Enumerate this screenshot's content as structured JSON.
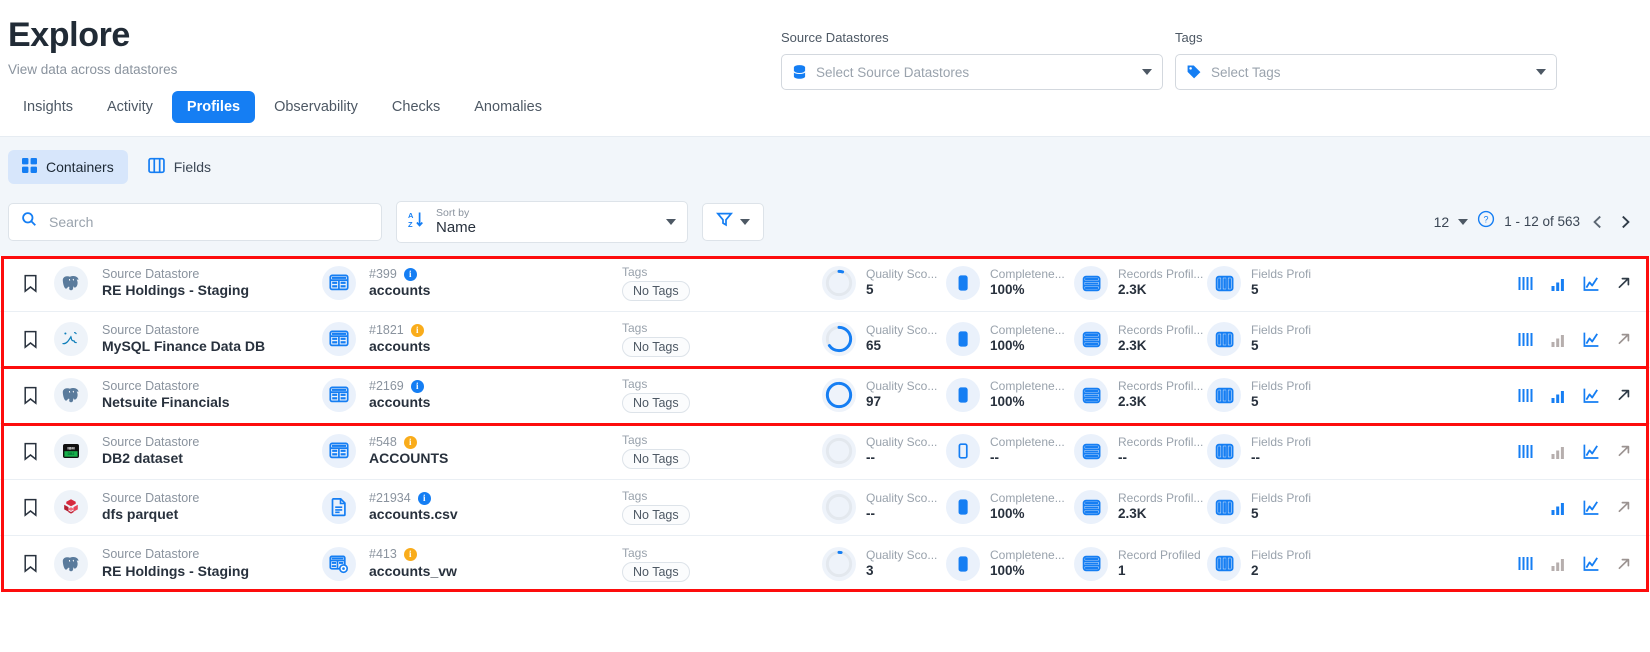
{
  "header": {
    "title": "Explore",
    "subtitle": "View data across datastores"
  },
  "filters": {
    "source_datastores": {
      "label": "Source Datastores",
      "placeholder": "Select Source Datastores",
      "icon": "database-icon",
      "caret": "chevron-down-icon"
    },
    "tags": {
      "label": "Tags",
      "placeholder": "Select Tags",
      "icon": "tag-icon",
      "caret": "chevron-down-icon"
    }
  },
  "tabs": [
    {
      "label": "Insights",
      "active": false
    },
    {
      "label": "Activity",
      "active": false
    },
    {
      "label": "Profiles",
      "active": true
    },
    {
      "label": "Observability",
      "active": false
    },
    {
      "label": "Checks",
      "active": false
    },
    {
      "label": "Anomalies",
      "active": false
    }
  ],
  "view_toggle": [
    {
      "label": "Containers",
      "icon": "grid-icon",
      "active": true
    },
    {
      "label": "Fields",
      "icon": "columns-icon",
      "active": false
    }
  ],
  "toolbar": {
    "search_placeholder": "Search",
    "search_value": "",
    "search_icon": "search-icon",
    "sort": {
      "caption": "Sort by",
      "value": "Name",
      "icon": "sort-az-icon"
    },
    "filter_button_icon": "funnel-icon",
    "page_size": "12",
    "help_icon": "help-circle-icon",
    "range": "1 - 12 of 563",
    "prev_icon": "chevron-left-icon",
    "next_icon": "chevron-right-icon"
  },
  "colors": {
    "accent": "#157ef3",
    "annotation": "#fd0d0d",
    "panel_bg": "#f2f6fa",
    "badge_bg": "#eaf1fb",
    "amber": "#f9ac1b"
  },
  "metric_labels": {
    "quality": "Quality Sco...",
    "completeness": "Completene...",
    "records": "Records Profil...",
    "records_singular": "Record Profiled",
    "fields": "Fields Profi"
  },
  "tags_caption": "Tags",
  "rows": [
    {
      "kind": "Source Datastore",
      "datastore": "RE Holdings - Staging",
      "logo": "postgresql-icon",
      "object_icon": "table-icon",
      "object_id": "#399",
      "info_badge": "blue",
      "object_name": "accounts",
      "tags": "No Tags",
      "quality_score": "5",
      "quality_pct": 5,
      "completeness": "100%",
      "completeness_pct": 100,
      "records_profiled": "2.3K",
      "records_label": "Records Profil...",
      "fields_profiled": "5",
      "actions": [
        "bars-icon",
        "bar-chart-icon",
        "line-chart-icon",
        "external-link-icon"
      ],
      "action_states": [
        "on",
        "on",
        "on",
        "on"
      ]
    },
    {
      "kind": "Source Datastore",
      "datastore": "MySQL Finance Data DB",
      "logo": "mysql-icon",
      "object_icon": "table-icon",
      "object_id": "#1821",
      "info_badge": "amber",
      "object_name": "accounts",
      "tags": "No Tags",
      "quality_score": "65",
      "quality_pct": 65,
      "completeness": "100%",
      "completeness_pct": 100,
      "records_profiled": "2.3K",
      "records_label": "Records Profil...",
      "fields_profiled": "5",
      "actions": [
        "bars-icon",
        "bar-chart-icon",
        "line-chart-icon",
        "external-link-icon"
      ],
      "action_states": [
        "on",
        "off",
        "on",
        "off"
      ]
    },
    {
      "kind": "Source Datastore",
      "datastore": "Netsuite Financials",
      "logo": "postgresql-icon",
      "object_icon": "table-icon",
      "object_id": "#2169",
      "info_badge": "blue",
      "object_name": "accounts",
      "tags": "No Tags",
      "quality_score": "97",
      "quality_pct": 97,
      "completeness": "100%",
      "completeness_pct": 100,
      "records_profiled": "2.3K",
      "records_label": "Records Profil...",
      "fields_profiled": "5",
      "actions": [
        "bars-icon",
        "bar-chart-icon",
        "line-chart-icon",
        "external-link-icon"
      ],
      "action_states": [
        "on",
        "on",
        "on",
        "on"
      ],
      "highlighted": true
    },
    {
      "kind": "Source Datastore",
      "datastore": "DB2 dataset",
      "logo": "db2-icon",
      "object_icon": "table-icon",
      "object_id": "#548",
      "info_badge": "amber",
      "object_name": "ACCOUNTS",
      "tags": "No Tags",
      "quality_score": "--",
      "quality_pct": 0,
      "completeness": "--",
      "completeness_pct": 0,
      "records_profiled": "--",
      "records_label": "Records Profil...",
      "fields_profiled": "--",
      "actions": [
        "bars-icon",
        "bar-chart-icon",
        "line-chart-icon",
        "external-link-icon"
      ],
      "action_states": [
        "on",
        "off",
        "on",
        "off"
      ]
    },
    {
      "kind": "Source Datastore",
      "datastore": "dfs parquet",
      "logo": "parquet-icon",
      "object_icon": "file-icon",
      "object_id": "#21934",
      "info_badge": "blue",
      "object_name": "accounts.csv",
      "tags": "No Tags",
      "quality_score": "--",
      "quality_pct": 0,
      "completeness": "100%",
      "completeness_pct": 100,
      "records_profiled": "2.3K",
      "records_label": "Records Profil...",
      "fields_profiled": "5",
      "actions": [
        "bar-chart-icon",
        "line-chart-icon",
        "external-link-icon"
      ],
      "action_states": [
        "on",
        "on",
        "off"
      ]
    },
    {
      "kind": "Source Datastore",
      "datastore": "RE Holdings - Staging",
      "logo": "postgresql-icon",
      "object_icon": "view-icon",
      "object_id": "#413",
      "info_badge": "amber",
      "object_name": "accounts_vw",
      "tags": "No Tags",
      "quality_score": "3",
      "quality_pct": 3,
      "completeness": "100%",
      "completeness_pct": 100,
      "records_profiled": "1",
      "records_label": "Record Profiled",
      "fields_profiled": "2",
      "actions": [
        "bars-icon",
        "bar-chart-icon",
        "line-chart-icon",
        "external-link-icon"
      ],
      "action_states": [
        "on",
        "off",
        "on",
        "off"
      ]
    }
  ]
}
